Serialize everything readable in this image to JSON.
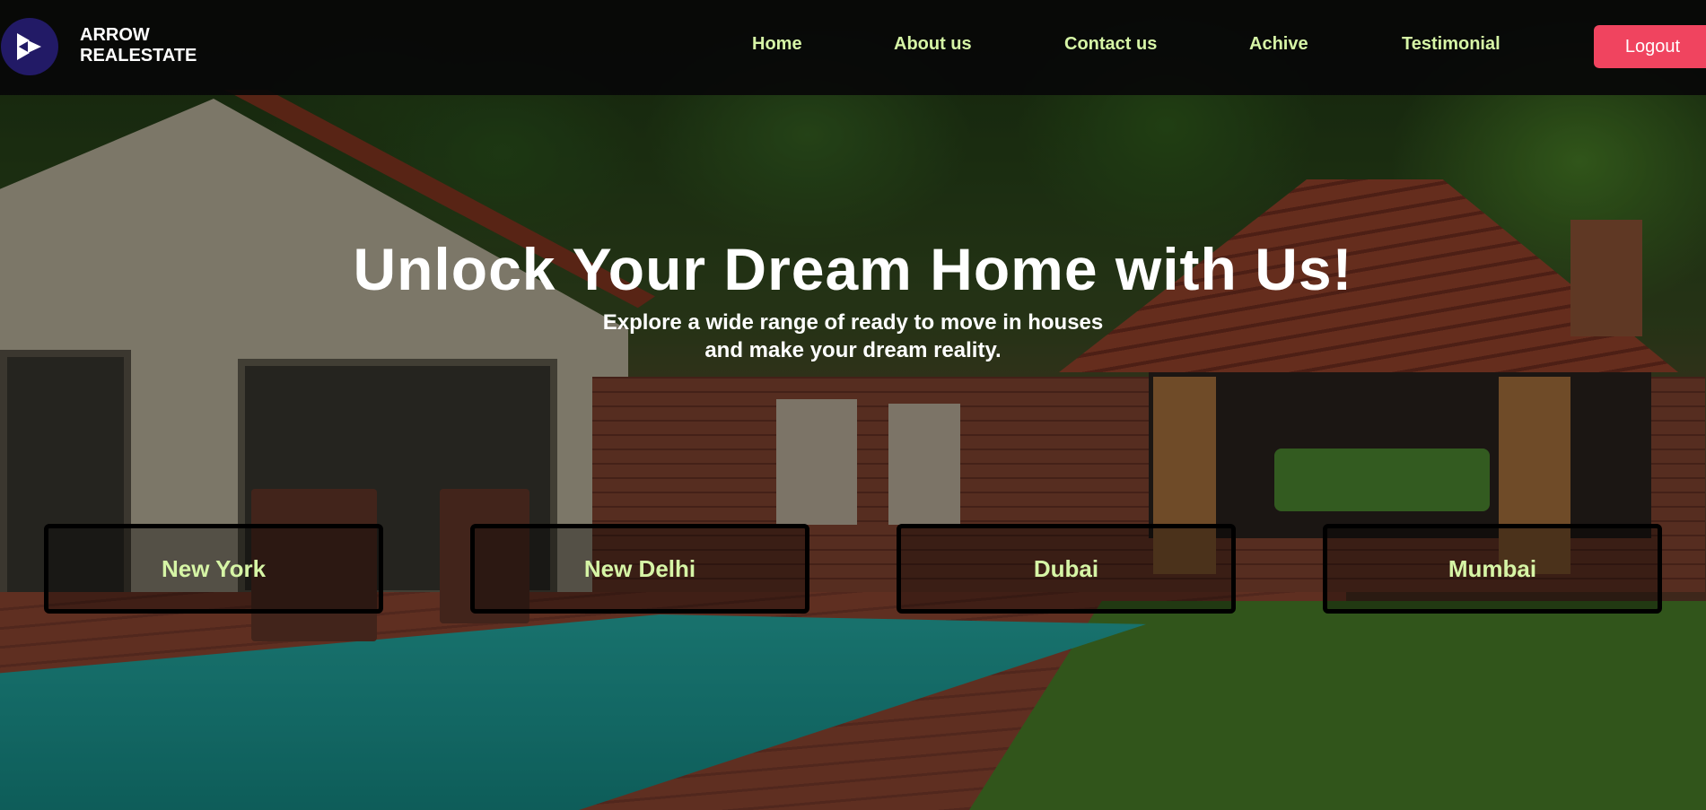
{
  "header": {
    "brand_line1": "ARROW",
    "brand_line2": "REALESTATE",
    "logo_icon": "double-chevron-right-icon",
    "nav_links": [
      "Home",
      "About us",
      "Contact us",
      "Achive",
      "Testimonial"
    ],
    "logout_label": "Logout"
  },
  "hero": {
    "title": "Unlock Your Dream Home with Us!",
    "subtitle_line1": "Explore a wide range of ready to move in houses",
    "subtitle_line2": "and make your dream reality."
  },
  "cities": [
    "New York",
    "New Delhi",
    "Dubai",
    "Mumbai"
  ],
  "colors": {
    "navbar_bg": "#080808",
    "logo_circle": "#221a66",
    "nav_link": "#d6f5a6",
    "logout_bg": "#f0445f",
    "hero_text": "#ffffff",
    "city_text": "#d6f5a6"
  }
}
